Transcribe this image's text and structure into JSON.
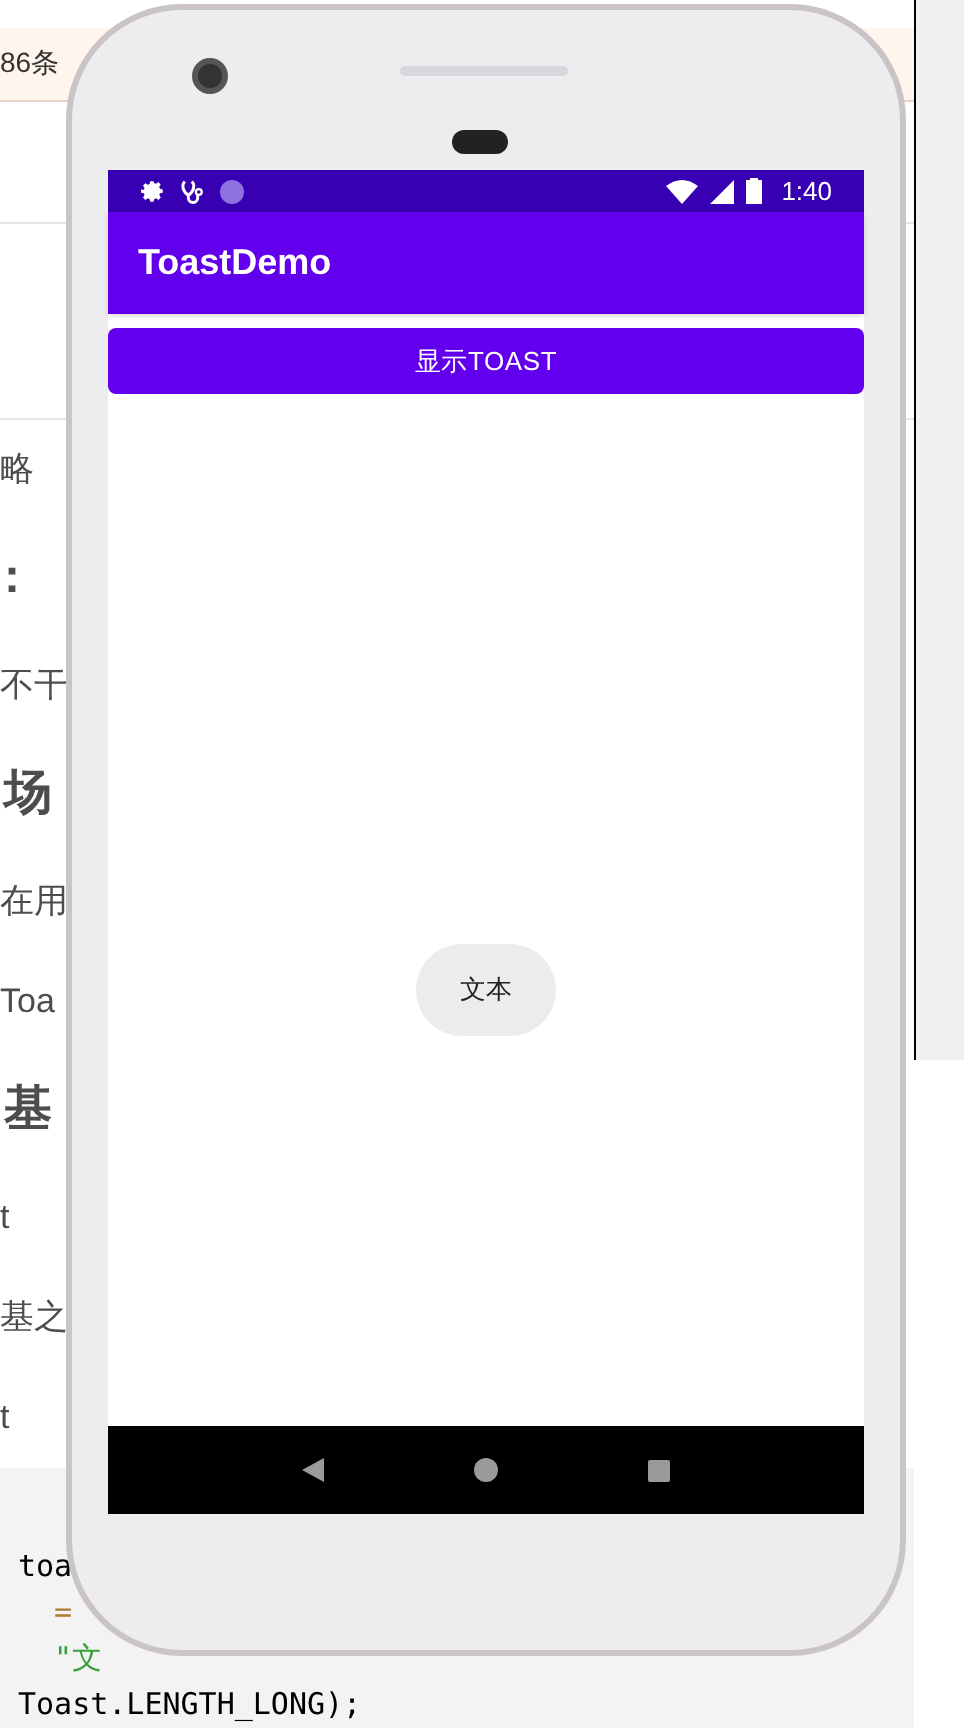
{
  "background_page": {
    "notice": "86条",
    "fragments": [
      {
        "kind": "body",
        "text": "略"
      },
      {
        "kind": "heading",
        "text": ":"
      },
      {
        "kind": "body",
        "text": "不干"
      },
      {
        "kind": "heading",
        "text": "场"
      },
      {
        "kind": "body",
        "text": "在用"
      },
      {
        "kind": "body",
        "text": "Toa"
      },
      {
        "kind": "heading",
        "text": "基"
      },
      {
        "kind": "body",
        "text": "t"
      },
      {
        "kind": "body",
        "text": "基之"
      },
      {
        "kind": "body",
        "text": "t"
      }
    ],
    "code_lines": [
      "toa",
      "=",
      "\"文",
      "Toast.LENGTH_LONG);"
    ]
  },
  "phone": {
    "status_bar": {
      "time": "1:40"
    },
    "app_bar": {
      "title": "ToastDemo"
    },
    "button": {
      "label": "显示TOAST"
    },
    "toast": {
      "text": "文本"
    }
  }
}
